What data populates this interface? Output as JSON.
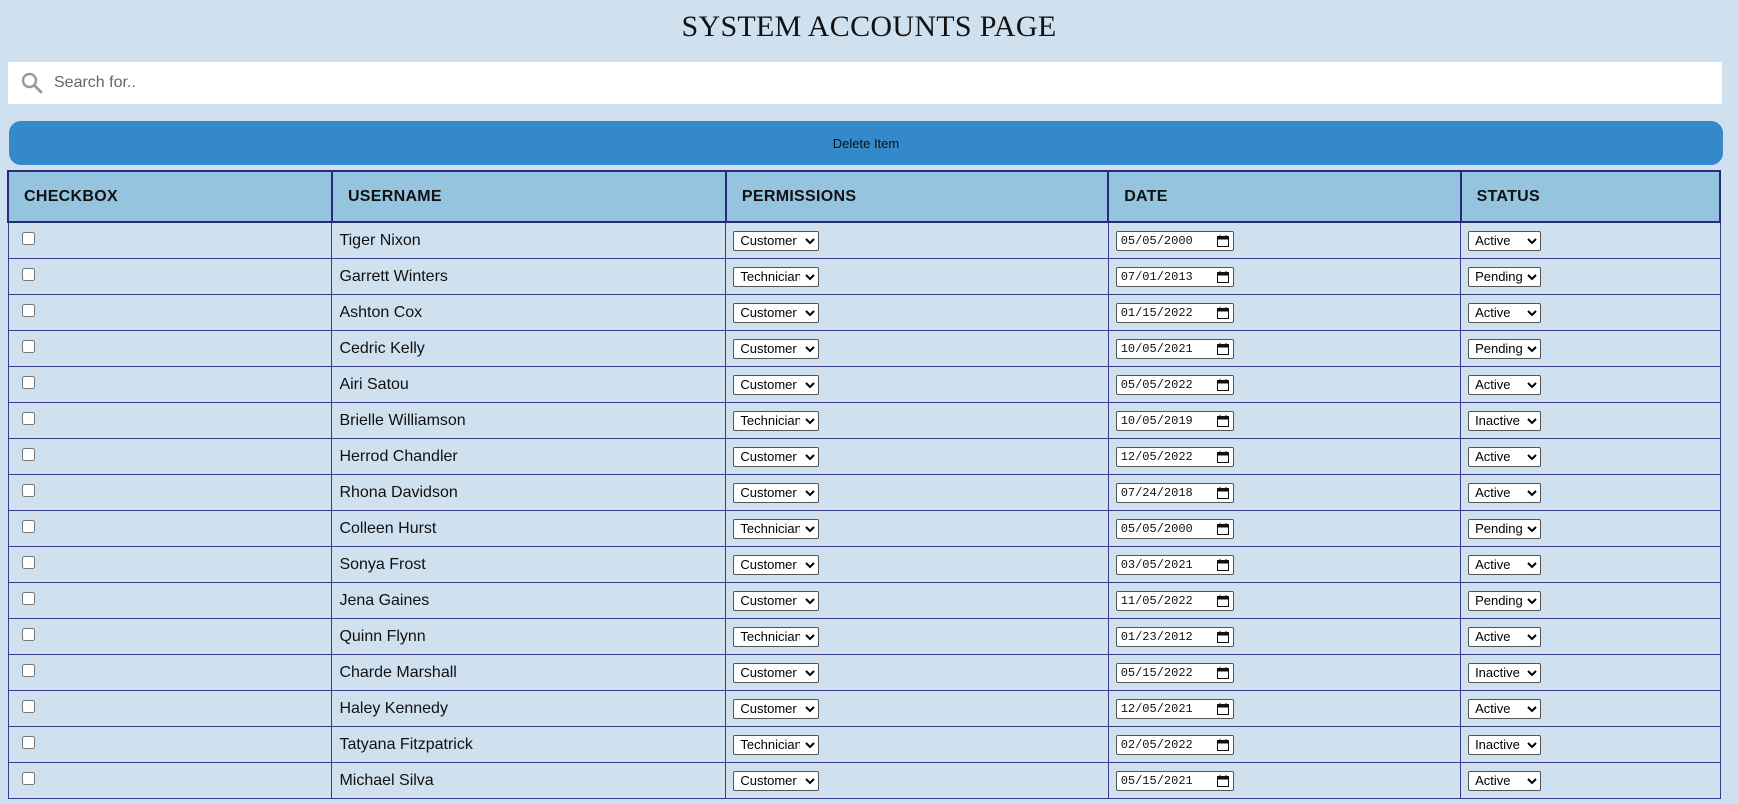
{
  "page": {
    "title": "SYSTEM ACCOUNTS PAGE"
  },
  "search": {
    "placeholder": "Search for..",
    "value": ""
  },
  "toolbar": {
    "delete_label": "Delete Item"
  },
  "table": {
    "headers": [
      "CHECKBOX",
      "USERNAME",
      "PERMISSIONS",
      "DATE",
      "STATUS"
    ],
    "rows": [
      {
        "checked": false,
        "username": "Tiger Nixon",
        "permission": "Customer",
        "date": "05/05/2000",
        "status": "Active"
      },
      {
        "checked": false,
        "username": "Garrett Winters",
        "permission": "Technician",
        "date": "07/01/2013",
        "status": "Pending"
      },
      {
        "checked": false,
        "username": "Ashton Cox",
        "permission": "Customer",
        "date": "01/15/2022",
        "status": "Active"
      },
      {
        "checked": false,
        "username": "Cedric Kelly",
        "permission": "Customer",
        "date": "10/05/2021",
        "status": "Pending"
      },
      {
        "checked": false,
        "username": "Airi Satou",
        "permission": "Customer",
        "date": "05/05/2022",
        "status": "Active"
      },
      {
        "checked": false,
        "username": "Brielle Williamson",
        "permission": "Technician",
        "date": "10/05/2019",
        "status": "Inactive"
      },
      {
        "checked": false,
        "username": "Herrod Chandler",
        "permission": "Customer",
        "date": "12/05/2022",
        "status": "Active"
      },
      {
        "checked": false,
        "username": "Rhona Davidson",
        "permission": "Customer",
        "date": "07/24/2018",
        "status": "Active"
      },
      {
        "checked": false,
        "username": "Colleen Hurst",
        "permission": "Technician",
        "date": "05/05/2000",
        "status": "Pending"
      },
      {
        "checked": false,
        "username": "Sonya Frost",
        "permission": "Customer",
        "date": "03/05/2021",
        "status": "Active"
      },
      {
        "checked": false,
        "username": "Jena Gaines",
        "permission": "Customer",
        "date": "11/05/2022",
        "status": "Pending"
      },
      {
        "checked": false,
        "username": "Quinn Flynn",
        "permission": "Technician",
        "date": "01/23/2012",
        "status": "Active"
      },
      {
        "checked": false,
        "username": "Charde Marshall",
        "permission": "Customer",
        "date": "05/15/2022",
        "status": "Inactive"
      },
      {
        "checked": false,
        "username": "Haley Kennedy",
        "permission": "Customer",
        "date": "12/05/2021",
        "status": "Active"
      },
      {
        "checked": false,
        "username": "Tatyana Fitzpatrick",
        "permission": "Technician",
        "date": "02/05/2022",
        "status": "Inactive"
      },
      {
        "checked": false,
        "username": "Michael Silva",
        "permission": "Customer",
        "date": "05/15/2021",
        "status": "Active"
      }
    ]
  },
  "icons": {
    "search": "search-icon",
    "calendar": "calendar-icon"
  },
  "colors": {
    "background": "#cfe0ee",
    "header": "#95c4de",
    "button": "#3489cb"
  }
}
